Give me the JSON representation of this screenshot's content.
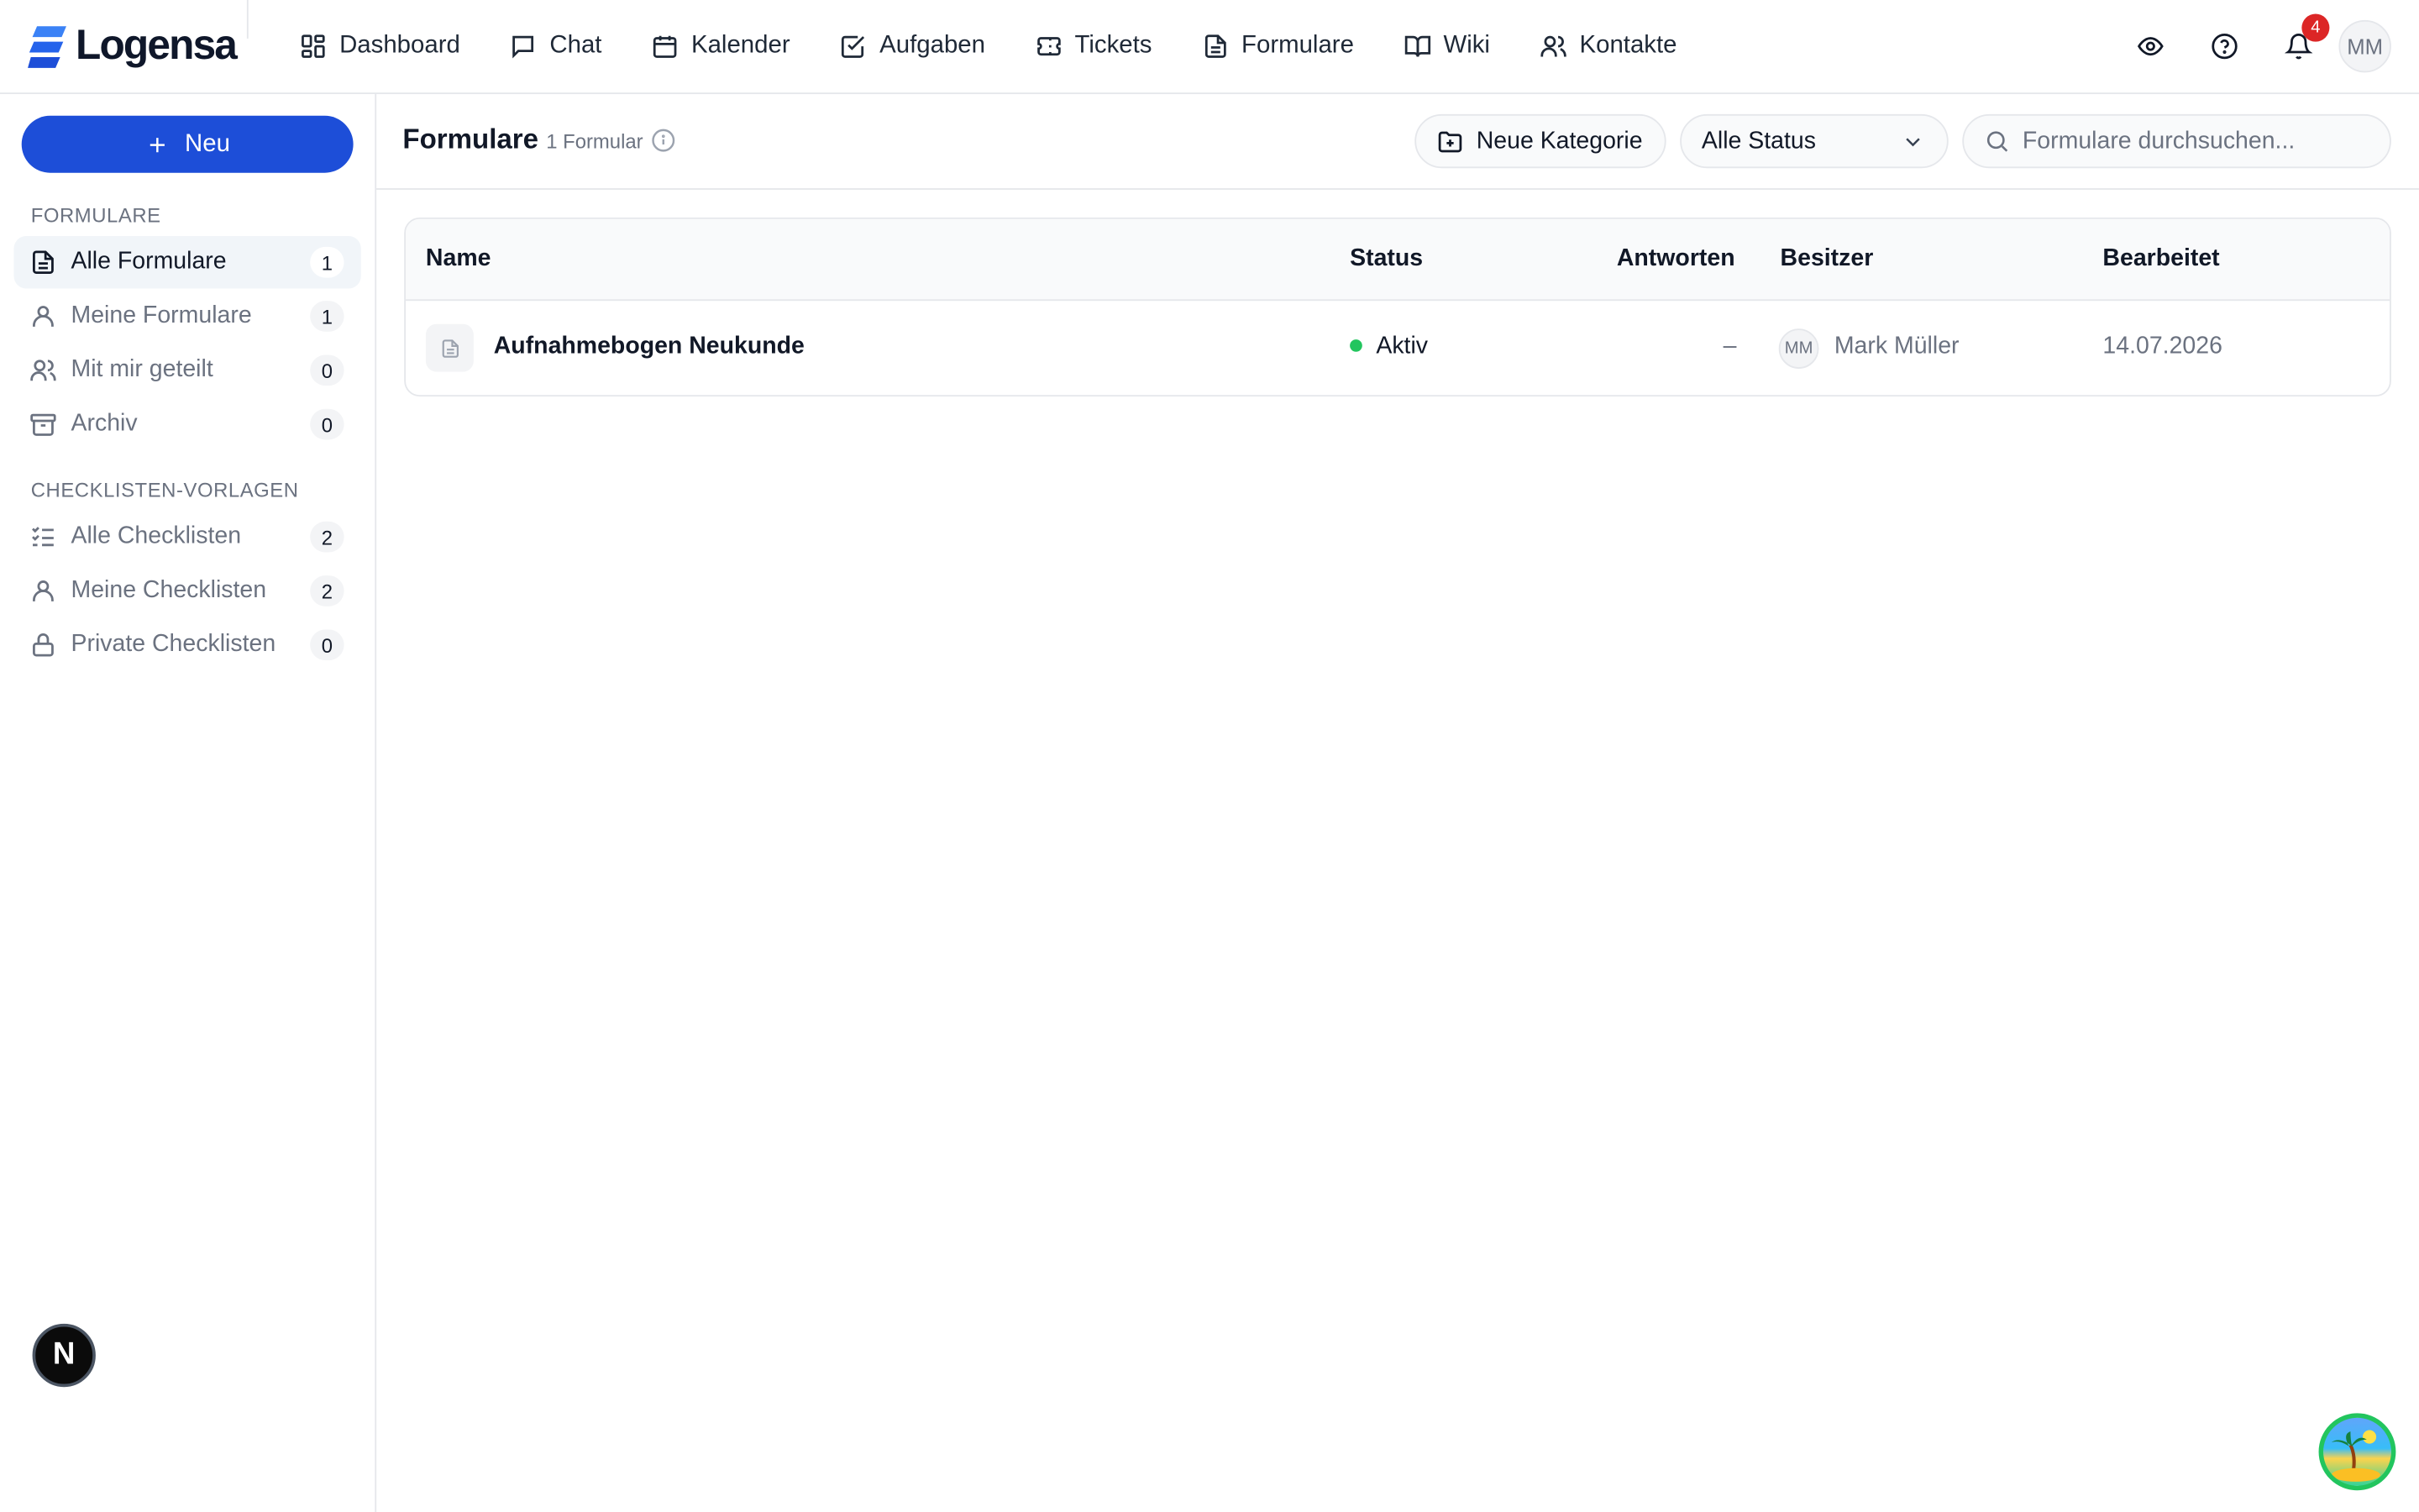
{
  "app": {
    "name": "Logensa",
    "brand_color": "#1d4ed8"
  },
  "nav": [
    {
      "label": "Dashboard",
      "icon": "dashboard-icon"
    },
    {
      "label": "Chat",
      "icon": "chat-icon"
    },
    {
      "label": "Kalender",
      "icon": "calendar-icon"
    },
    {
      "label": "Aufgaben",
      "icon": "task-icon"
    },
    {
      "label": "Tickets",
      "icon": "ticket-icon"
    },
    {
      "label": "Formulare",
      "icon": "form-icon"
    },
    {
      "label": "Wiki",
      "icon": "book-icon"
    },
    {
      "label": "Kontakte",
      "icon": "contacts-icon"
    }
  ],
  "topbar": {
    "notification_count": "4",
    "user_initials": "MM"
  },
  "sidebar": {
    "new_label": "Neu",
    "forms_section": "FORMULARE",
    "forms_items": [
      {
        "label": "Alle Formulare",
        "count": "1",
        "icon": "document-icon"
      },
      {
        "label": "Meine Formulare",
        "count": "1",
        "icon": "user-icon"
      },
      {
        "label": "Mit mir geteilt",
        "count": "0",
        "icon": "users-icon"
      },
      {
        "label": "Archiv",
        "count": "0",
        "icon": "archive-icon"
      }
    ],
    "checklist_section": "CHECKLISTEN-VORLAGEN",
    "checklist_items": [
      {
        "label": "Alle Checklisten",
        "count": "2",
        "icon": "list-check-icon"
      },
      {
        "label": "Meine Checklisten",
        "count": "2",
        "icon": "user-icon"
      },
      {
        "label": "Private Checklisten",
        "count": "0",
        "icon": "lock-icon"
      }
    ],
    "bottom_badge": "N"
  },
  "main": {
    "title": "Formulare",
    "count_label": "1 Formular",
    "new_category_label": "Neue Kategorie",
    "status_filter": "Alle Status",
    "search_placeholder": "Formulare durchsuchen...",
    "table": {
      "columns": [
        "Name",
        "Status",
        "Antworten",
        "Besitzer",
        "Bearbeitet"
      ],
      "rows": [
        {
          "name": "Aufnahmebogen Neukunde",
          "status": "Aktiv",
          "status_color": "#22c55e",
          "responses": "–",
          "owner_initials": "MM",
          "owner": "Mark Müller",
          "edited": "14.07.2026"
        }
      ]
    }
  }
}
